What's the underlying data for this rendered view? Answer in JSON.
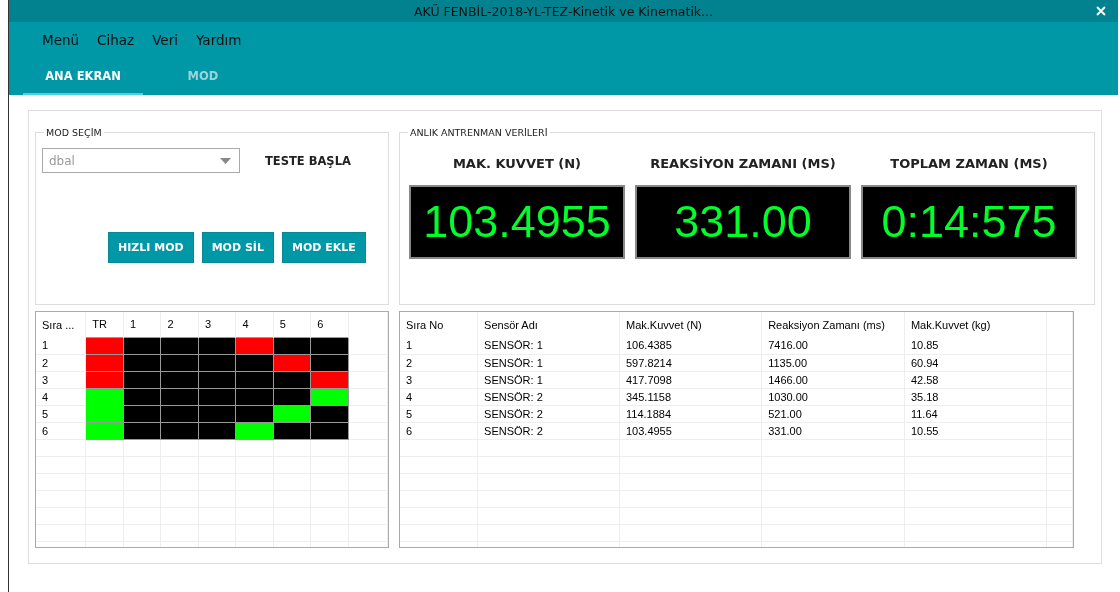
{
  "window": {
    "title": "AKÜ FENBİL-2018-YL-TEZ-Kinetik ve Kinematik..."
  },
  "menu": [
    "Menü",
    "Cihaz",
    "Veri",
    "Yardım"
  ],
  "tabs": [
    {
      "label": "ANA EKRAN",
      "selected": true
    },
    {
      "label": "MOD",
      "selected": false
    }
  ],
  "mode_panel": {
    "title": "MOD SEÇİM",
    "dropdown": {
      "value": "dbal"
    },
    "start_label": "TESTE BAŞLA",
    "buttons": [
      "HIZLI MOD",
      "MOD SİL",
      "MOD EKLE"
    ]
  },
  "live_panel": {
    "title": "ANLIK ANTRENMAN VERİLERİ",
    "displays": [
      {
        "label": "MAK. KUVVET (N)",
        "value": "103.4955"
      },
      {
        "label": "REAKSİYON ZAMANI (MS)",
        "value": "331.00"
      },
      {
        "label": "TOPLAM ZAMAN (MS)",
        "value": "0:14:575"
      }
    ]
  },
  "sensor_grid": {
    "columns": [
      "Sıra ...",
      "TR",
      "1",
      "2",
      "3",
      "4",
      "5",
      "6"
    ],
    "rows": [
      {
        "label": "1",
        "cells": [
          {
            "color": "#ff0000"
          },
          {
            "color": "#000000"
          },
          {
            "color": "#000000"
          },
          {
            "color": "#000000"
          },
          {
            "color": "#ff0000"
          },
          {
            "color": "#000000"
          },
          {
            "color": "#000000"
          }
        ]
      },
      {
        "label": "2",
        "cells": [
          {
            "color": "#ff0000"
          },
          {
            "color": "#000000"
          },
          {
            "color": "#000000"
          },
          {
            "color": "#000000"
          },
          {
            "color": "#000000"
          },
          {
            "color": "#ff0000"
          },
          {
            "color": "#000000"
          }
        ]
      },
      {
        "label": "3",
        "cells": [
          {
            "color": "#ff0000"
          },
          {
            "color": "#000000"
          },
          {
            "color": "#000000"
          },
          {
            "color": "#000000"
          },
          {
            "color": "#000000"
          },
          {
            "color": "#000000"
          },
          {
            "color": "#ff0000"
          }
        ]
      },
      {
        "label": "4",
        "cells": [
          {
            "color": "#00ff00"
          },
          {
            "color": "#000000"
          },
          {
            "color": "#000000"
          },
          {
            "color": "#000000"
          },
          {
            "color": "#000000"
          },
          {
            "color": "#000000"
          },
          {
            "color": "#00ff00"
          }
        ]
      },
      {
        "label": "5",
        "cells": [
          {
            "color": "#00ff00"
          },
          {
            "color": "#000000"
          },
          {
            "color": "#000000"
          },
          {
            "color": "#000000"
          },
          {
            "color": "#000000"
          },
          {
            "color": "#00ff00"
          },
          {
            "color": "#000000"
          }
        ]
      },
      {
        "label": "6",
        "cells": [
          {
            "color": "#00ff00"
          },
          {
            "color": "#000000"
          },
          {
            "color": "#000000"
          },
          {
            "color": "#000000"
          },
          {
            "color": "#00ff00"
          },
          {
            "color": "#000000"
          },
          {
            "color": "#000000"
          }
        ]
      }
    ]
  },
  "results_table": {
    "columns": [
      "Sıra No",
      "Sensör Adı",
      "Mak.Kuvvet (N)",
      "Reaksiyon Zamanı (ms)",
      "Mak.Kuvvet (kg)"
    ],
    "rows": [
      [
        "1",
        "SENSÖR: 1",
        "106.4385",
        "7416.00",
        "10.85"
      ],
      [
        "2",
        "SENSÖR: 1",
        "597.8214",
        "1135.00",
        "60.94"
      ],
      [
        "3",
        "SENSÖR: 1",
        "417.7098",
        "1466.00",
        "42.58"
      ],
      [
        "4",
        "SENSÖR: 2",
        "345.1158",
        "1030.00",
        "35.18"
      ],
      [
        "5",
        "SENSÖR: 2",
        "114.1884",
        "521.00",
        "11.64"
      ],
      [
        "6",
        "SENSÖR: 2",
        "103.4955",
        "331.00",
        "10.55"
      ]
    ]
  }
}
